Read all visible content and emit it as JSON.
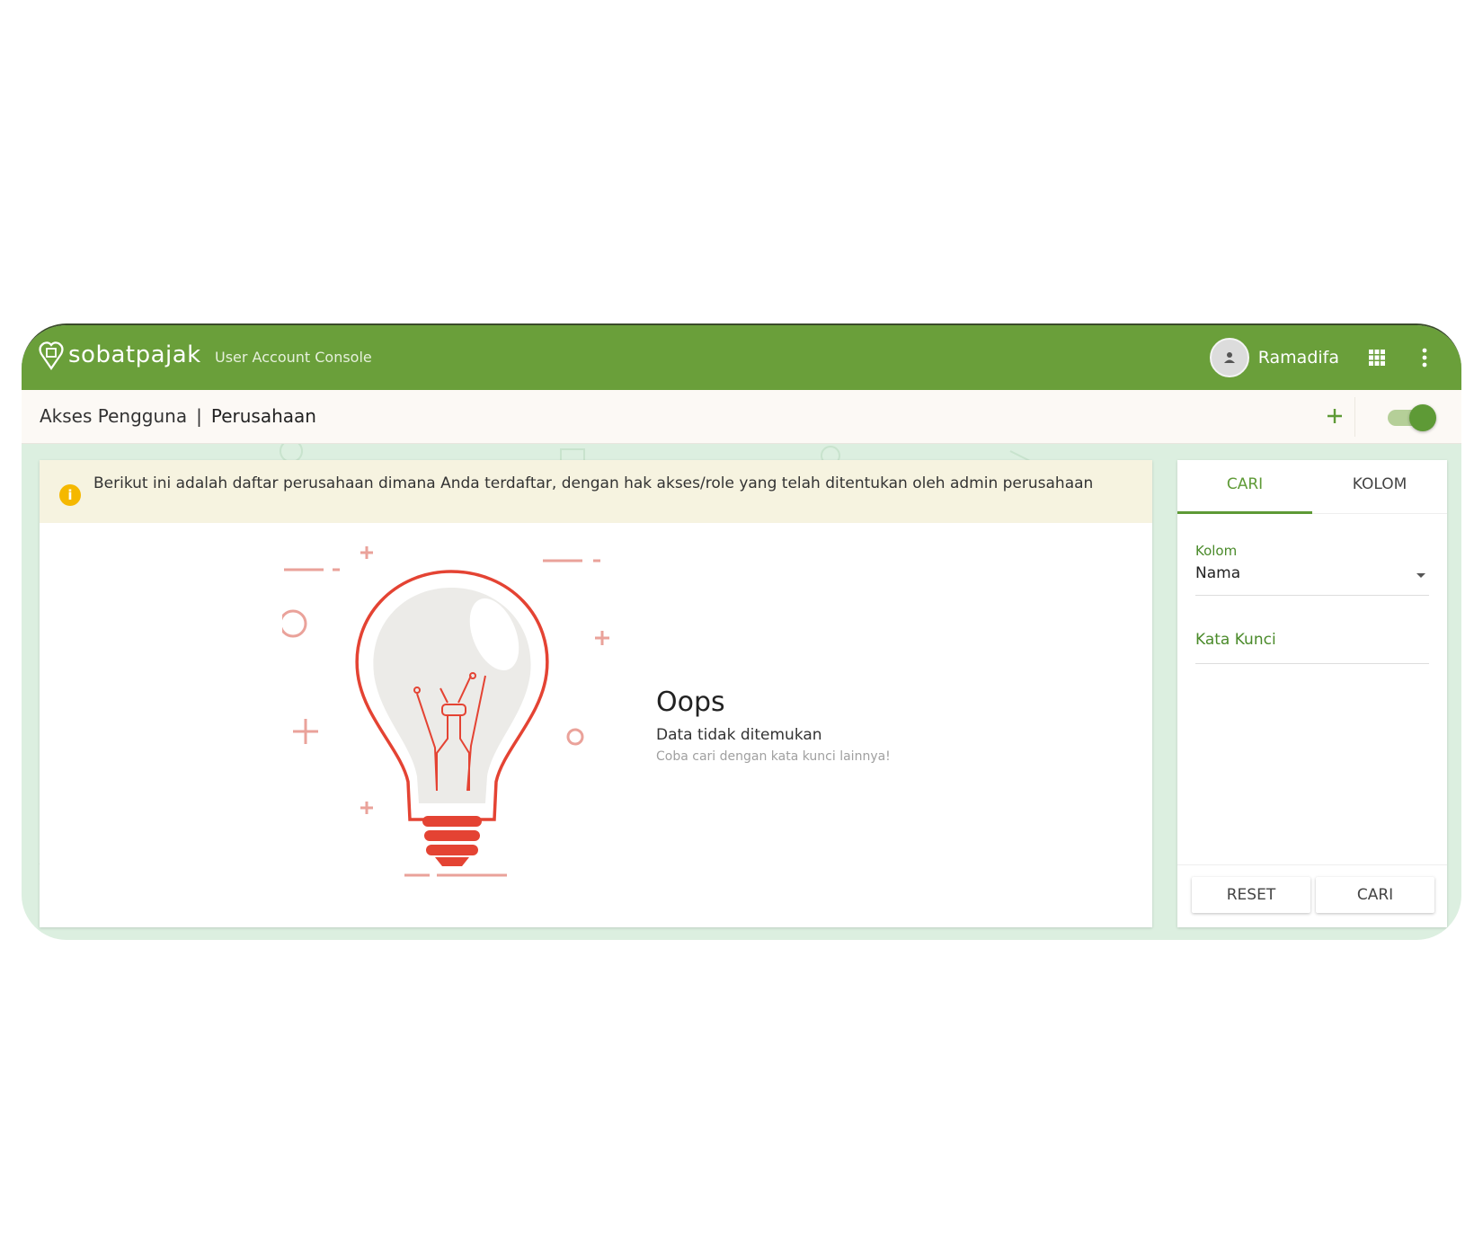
{
  "app": {
    "brand_name": "sobatpajak",
    "console_label": "User Account Console",
    "user_name": "Ramadifa",
    "accent_color": "#6a9f3a"
  },
  "toolbar": {
    "breadcrumb_parent": "Akses Pengguna",
    "breadcrumb_separator": "|",
    "breadcrumb_current": "Perusahaan",
    "toggle_on": true
  },
  "alert": {
    "text": "Berikut ini adalah daftar perusahaan dimana Anda terdaftar, dengan hak akses/role yang telah ditentukan oleh admin perusahaan",
    "icon_text": "i"
  },
  "empty_state": {
    "title": "Oops",
    "subtitle": "Data tidak ditemukan",
    "hint": "Coba cari dengan kata kunci lainnya!"
  },
  "side_panel": {
    "tabs": [
      {
        "label": "CARI",
        "active": true
      },
      {
        "label": "KOLOM",
        "active": false
      }
    ],
    "kolom_label": "Kolom",
    "kolom_value": "Nama",
    "keyword_label": "Kata Kunci",
    "reset_label": "RESET",
    "search_label": "CARI"
  }
}
